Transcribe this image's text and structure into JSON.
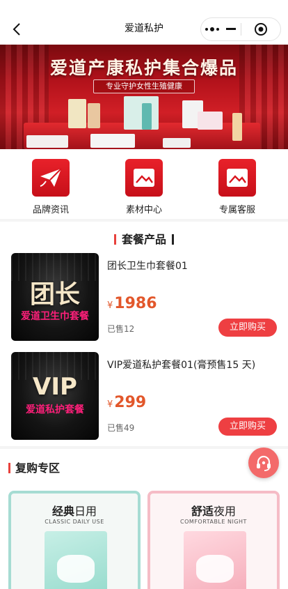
{
  "nav": {
    "title": "爱道私护"
  },
  "banner": {
    "title": "爱道产康私护集合爆品",
    "subtitle": "专业守护女性生殖健康"
  },
  "menu": {
    "items": [
      {
        "label": "品牌资讯",
        "icon": "paper-plane-icon"
      },
      {
        "label": "素材中心",
        "icon": "image-icon"
      },
      {
        "label": "专属客服",
        "icon": "image-icon"
      }
    ]
  },
  "packages": {
    "title": "套餐产品",
    "items": [
      {
        "name": "团长卫生巾套餐01",
        "currency": "¥",
        "price": "1986",
        "sold": "已售12",
        "buy_label": "立即购买",
        "thumb_big": "团长",
        "thumb_tag": "爱道卫生巾套餐"
      },
      {
        "name": "VIP爱道私护套餐01(膏预售15 天)",
        "currency": "¥",
        "price": "299",
        "sold": "已售49",
        "buy_label": "立即购买",
        "thumb_big": "VIP",
        "thumb_tag": "爱道私护套餐"
      }
    ]
  },
  "repurchase": {
    "title": "复购专区",
    "cards": [
      {
        "head_bold": "经典",
        "head_light": "日用",
        "sub": "CLASSIC DAILY USE"
      },
      {
        "head_bold": "舒适",
        "head_light": "夜用",
        "sub": "COMFORTABLE NIGHT"
      }
    ]
  },
  "colors": {
    "accent": "#e8413c",
    "price": "#e2572b",
    "buy_button": "#ee3f42",
    "menu_icon": "#e8212a"
  }
}
